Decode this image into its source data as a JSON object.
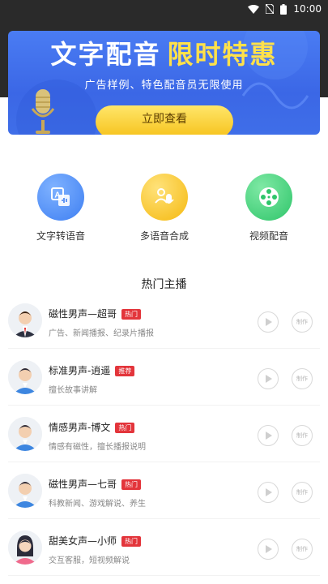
{
  "status_bar": {
    "time": "10:00"
  },
  "banner": {
    "title_main": "文字配音",
    "title_highlight": "限时特惠",
    "subtitle": "广告样例、特色配音员无限使用",
    "button_label": "立即查看"
  },
  "features": [
    {
      "label": "文字转语音",
      "icon": "text-to-speech-icon",
      "color": "#4d8df5"
    },
    {
      "label": "多语音合成",
      "icon": "multi-voice-icon",
      "color": "#f9c21f"
    },
    {
      "label": "视频配音",
      "icon": "video-dubbing-icon",
      "color": "#3fcf77"
    }
  ],
  "section_title": "热门主播",
  "anchors": [
    {
      "name": "磁性男声—超哥",
      "badge": "热门",
      "badge_color": "#e3353b",
      "desc": "广告、新闻播报、纪录片播报",
      "avatar": "male-suit",
      "play": "play",
      "make": "制作"
    },
    {
      "name": "标准男声-逍遥",
      "badge": "推荐",
      "badge_color": "#e3353b",
      "desc": "擅长故事讲解",
      "avatar": "male-blue",
      "play": "play",
      "make": "制作"
    },
    {
      "name": "情感男声-博文",
      "badge": "热门",
      "badge_color": "#e3353b",
      "desc": "情感有磁性，擅长播报说明",
      "avatar": "male-blue",
      "play": "play",
      "make": "制作"
    },
    {
      "name": "磁性男声—七哥",
      "badge": "热门",
      "badge_color": "#e3353b",
      "desc": "科教新闻、游戏解说、养生",
      "avatar": "male-blue",
      "play": "play",
      "make": "制作"
    },
    {
      "name": "甜美女声—小师",
      "badge": "热门",
      "badge_color": "#e3353b",
      "desc": "交互客服，短视频解说",
      "avatar": "female",
      "play": "play",
      "make": "制作"
    }
  ]
}
